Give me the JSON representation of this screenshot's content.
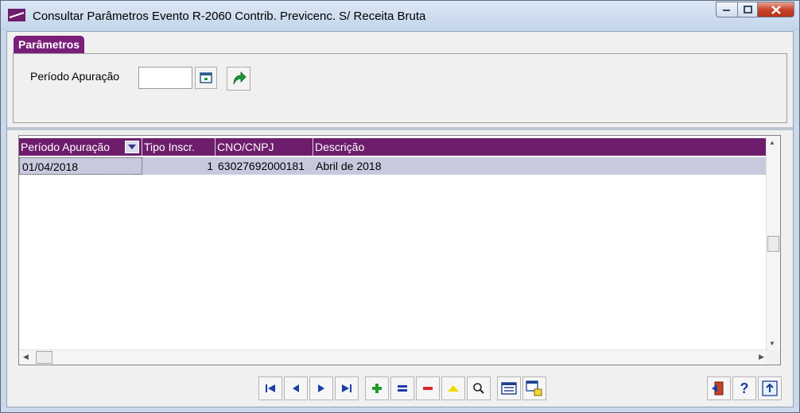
{
  "window": {
    "title": "Consultar Parâmetros Evento R-2060 Contrib. Previcenc. S/ Receita Bruta",
    "controls": [
      "minimize-icon",
      "maximize-icon",
      "close-icon"
    ]
  },
  "params": {
    "tab_label": "Parâmetros",
    "periodo_label": "Período Apuração",
    "periodo_value": ""
  },
  "grid": {
    "columns": [
      "Período Apuração",
      "Tipo Inscr.",
      "CNO/CNPJ",
      "Descrição"
    ],
    "rows": [
      {
        "periodo": "01/04/2018",
        "tipo": "1",
        "cnpj": "63027692000181",
        "descricao": "Abril de 2018"
      }
    ]
  },
  "toolbar": {
    "nav": [
      "first-record-icon",
      "prior-record-icon",
      "next-record-icon",
      "last-record-icon"
    ],
    "edit": [
      "insert-icon",
      "edit-icon",
      "delete-icon",
      "post-icon",
      "search-icon"
    ],
    "views": [
      "form-view-icon",
      "export-icon"
    ],
    "right": [
      "exit-icon",
      "help-icon",
      "about-icon"
    ]
  },
  "colors": {
    "accent": "#6d1d6c",
    "row_selected": "#c9c9de"
  }
}
